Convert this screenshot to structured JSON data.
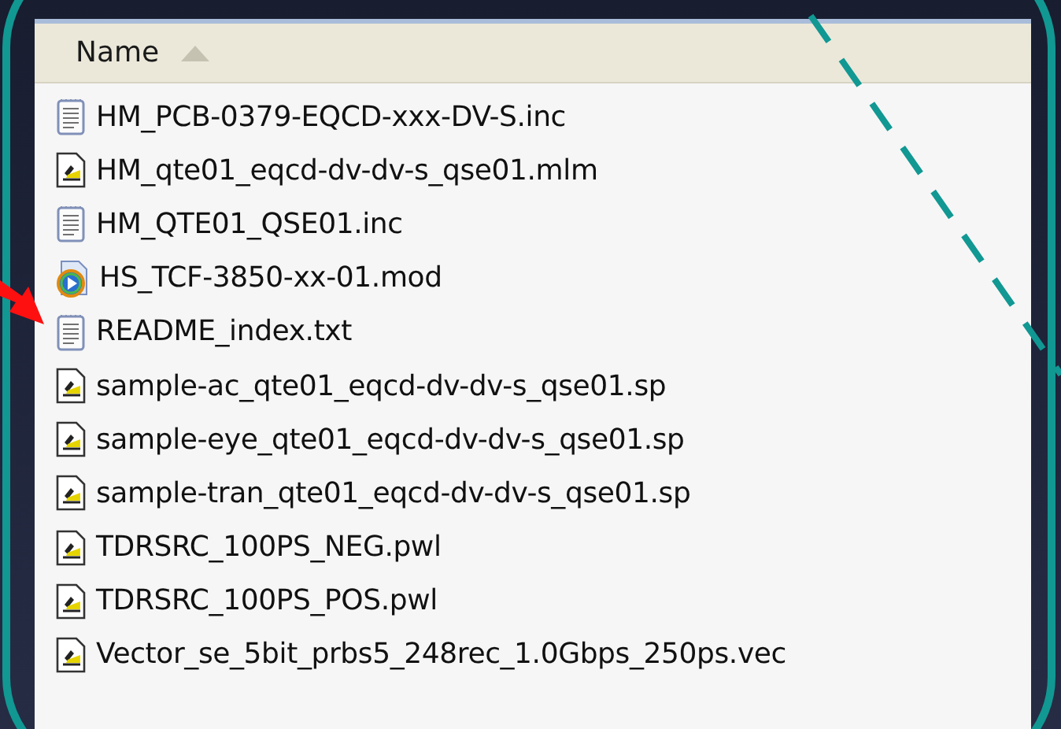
{
  "column_header": {
    "label": "Name",
    "sort_ascending": true
  },
  "files": [
    {
      "name": "HM_PCB-0379-EQCD-xxx-DV-S.inc",
      "kind": "text"
    },
    {
      "name": "HM_qte01_eqcd-dv-dv-s_qse01.mlm",
      "kind": "script"
    },
    {
      "name": "HM_QTE01_QSE01.inc",
      "kind": "text"
    },
    {
      "name": "HS_TCF-3850-xx-01.mod",
      "kind": "media"
    },
    {
      "name": "README_index.txt",
      "kind": "text"
    },
    {
      "name": "sample-ac_qte01_eqcd-dv-dv-s_qse01.sp",
      "kind": "script"
    },
    {
      "name": "sample-eye_qte01_eqcd-dv-dv-s_qse01.sp",
      "kind": "script"
    },
    {
      "name": "sample-tran_qte01_eqcd-dv-dv-s_qse01.sp",
      "kind": "script"
    },
    {
      "name": "TDRSRC_100PS_NEG.pwl",
      "kind": "script"
    },
    {
      "name": "TDRSRC_100PS_POS.pwl",
      "kind": "script"
    },
    {
      "name": "Vector_se_5bit_prbs5_248rec_1.0Gbps_250ps.vec",
      "kind": "script"
    }
  ]
}
